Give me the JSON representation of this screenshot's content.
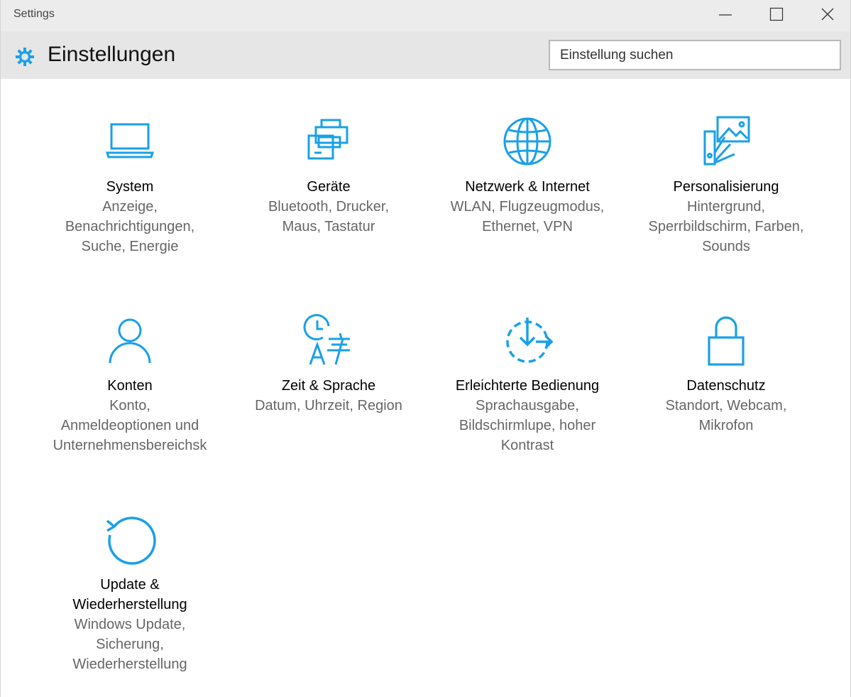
{
  "window": {
    "title": "Settings"
  },
  "header": {
    "title": "Einstellungen"
  },
  "search": {
    "placeholder": "Einstellung suchen"
  },
  "colors": {
    "accent": "#1aa0e8",
    "header_bg": "#e6e6e6",
    "titlebar_bg": "#ececec",
    "desc_text": "#666666"
  },
  "tiles": [
    {
      "icon": "laptop-icon",
      "label": "System",
      "desc": "Anzeige,\nBenachrichtigungen,\nSuche, Energie"
    },
    {
      "icon": "devices-icon",
      "label": "Geräte",
      "desc": "Bluetooth, Drucker,\nMaus, Tastatur"
    },
    {
      "icon": "globe-icon",
      "label": "Netzwerk & Internet",
      "desc": "WLAN, Flugzeugmodus,\nEthernet, VPN"
    },
    {
      "icon": "personalization-icon",
      "label": "Personalisierung",
      "desc": "Hintergrund,\nSperrbildschirm, Farben,\nSounds"
    },
    {
      "icon": "person-icon",
      "label": "Konten",
      "desc": "Konto,\nAnmeldeoptionen und\nUnternehmensbereichsk"
    },
    {
      "icon": "time-language-icon",
      "label": "Zeit & Sprache",
      "desc": "Datum, Uhrzeit, Region"
    },
    {
      "icon": "ease-of-access-icon",
      "label": "Erleichterte Bedienung",
      "desc": "Sprachausgabe,\nBildschirmlupe, hoher\nKontrast"
    },
    {
      "icon": "lock-icon",
      "label": "Datenschutz",
      "desc": "Standort, Webcam,\nMikrofon"
    },
    {
      "icon": "update-icon",
      "label": "Update &\nWiederherstellung",
      "desc": "Windows Update,\nSicherung,\nWiederherstellung"
    }
  ]
}
